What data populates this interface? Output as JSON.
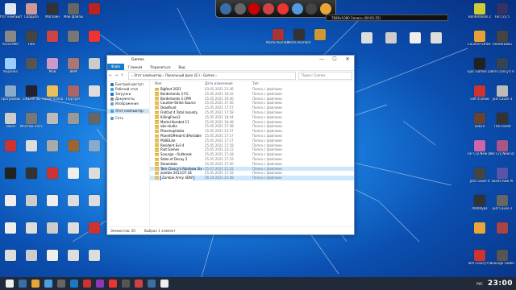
{
  "desktop": {
    "left_icons": [
      {
        "label": "Этот компьютер",
        "color": "#dfe8f5"
      },
      {
        "label": "Свадьба",
        "color": "#c99"
      },
      {
        "label": "Магазин",
        "color": "#333"
      },
      {
        "label": "Мои файлы",
        "color": "#666"
      },
      {
        "label": "",
        "color": "#b22"
      },
      {
        "label": "AccessMU",
        "color": "#888"
      },
      {
        "label": "Foto",
        "color": "#444"
      },
      {
        "label": "",
        "color": "#c44"
      },
      {
        "label": "",
        "color": "#777"
      },
      {
        "label": "",
        "color": "#e33"
      },
      {
        "label": "Корзина",
        "color": "#9cf"
      },
      {
        "label": "",
        "color": "#555"
      },
      {
        "label": "Мой",
        "color": "#c9c"
      },
      {
        "label": "ВКМ",
        "color": "#a77"
      },
      {
        "label": "",
        "color": "#ccc"
      },
      {
        "label": "Программы",
        "color": "#8ac"
      },
      {
        "label": "CINEMA 4D",
        "color": "#223"
      },
      {
        "label": "Новая папка",
        "color": "#e9c15a"
      },
      {
        "label": "Портрет",
        "color": "#a66"
      },
      {
        "label": "",
        "color": "#ddd"
      },
      {
        "label": "Заказ",
        "color": "#ccc"
      },
      {
        "label": "Монтаж 2021",
        "color": "#777"
      },
      {
        "label": "",
        "color": "#bbb"
      },
      {
        "label": "",
        "color": "#999"
      },
      {
        "label": "",
        "color": "#666"
      },
      {
        "label": "",
        "color": "#c33"
      },
      {
        "label": "",
        "color": "#ddd"
      },
      {
        "label": "",
        "color": "#aaa"
      },
      {
        "label": "",
        "color": "#963"
      },
      {
        "label": "",
        "color": "#8ac"
      },
      {
        "label": "",
        "color": "#222"
      },
      {
        "label": "",
        "color": "#333"
      },
      {
        "label": "",
        "color": "#c33"
      },
      {
        "label": "",
        "color": "#eee"
      },
      {
        "label": "",
        "color": "#ddd"
      },
      {
        "label": "",
        "color": "#eee"
      },
      {
        "label": "",
        "color": "#ccc"
      },
      {
        "label": "",
        "color": "#eee"
      },
      {
        "label": "",
        "color": "#ddd"
      },
      {
        "label": "",
        "color": "#ddd"
      },
      {
        "label": "",
        "color": "#eee"
      },
      {
        "label": "",
        "color": "#ddd"
      },
      {
        "label": "",
        "color": "#ccc"
      },
      {
        "label": "",
        "color": "#ddd"
      },
      {
        "label": "",
        "color": "#c33"
      },
      {
        "label": "",
        "color": "#ddd"
      },
      {
        "label": "",
        "color": "#ccc"
      },
      {
        "label": "",
        "color": "#eee"
      },
      {
        "label": "",
        "color": "#ddd"
      },
      {
        "label": "",
        "color": "#ddd"
      }
    ],
    "right_icons": [
      {
        "label": "Borderlands 2",
        "color": "#cc3"
      },
      {
        "label": "Far Cry 5",
        "color": "#336"
      },
      {
        "label": "Counter-Strike Global Off...",
        "color": "#e7a13a"
      },
      {
        "label": "RocketDoku",
        "color": "#444"
      },
      {
        "label": "Epic Games Launcher",
        "color": "#222"
      },
      {
        "label": "Tom Clancy's Rainbow Six",
        "color": "#345"
      },
      {
        "label": "Left 4 Dead",
        "color": "#c33"
      },
      {
        "label": "Just Cause 3",
        "color": "#bbb"
      },
      {
        "label": "Sekiro",
        "color": "#643"
      },
      {
        "label": "The Forest",
        "color": "#333"
      },
      {
        "label": "Far Cry New Dawn",
        "color": "#c6a"
      },
      {
        "label": "Far Cry New Dawn",
        "color": "#a58"
      },
      {
        "label": "Just Cause 4",
        "color": "#444"
      },
      {
        "label": "Saints Row IV",
        "color": "#55a"
      },
      {
        "label": "Prototype",
        "color": "#333"
      },
      {
        "label": "Just Cause 2",
        "color": "#666"
      },
      {
        "label": "",
        "color": "#e8a53a"
      },
      {
        "label": "",
        "color": "#a44"
      },
      {
        "label": "Tom Clancy's Rainbow Six",
        "color": "#c33"
      },
      {
        "label": "Scourge Outbreak",
        "color": "#555"
      }
    ],
    "mid_icons": [
      {
        "label": "Mortal Kombat 11",
        "color": "#a33"
      },
      {
        "label": "Mortal Kombat 11",
        "color": "#333"
      },
      {
        "label": "",
        "color": "#c93"
      },
      {
        "label": "",
        "color": "#ddd"
      },
      {
        "label": "",
        "color": "#ccc"
      },
      {
        "label": "",
        "color": "#eee"
      },
      {
        "label": "",
        "color": "#ddd"
      }
    ]
  },
  "dock": {
    "icons": [
      "#3a6ea8",
      "#666",
      "#c00",
      "#c44",
      "#e33",
      "#5599dd",
      "#444",
      "#e8a53a"
    ]
  },
  "hud": {
    "text": "7680x1080   Запись (00:01:25)"
  },
  "explorer": {
    "title": "Games",
    "window_controls": [
      "—",
      "☐",
      "✕"
    ],
    "ribbon": {
      "file": "Файл",
      "tabs": [
        "Главная",
        "Поделиться",
        "Вид"
      ]
    },
    "address": {
      "path": "›  Этот компьютер  ›  Локальный диск (E:)  ›  Games  ›",
      "search": "Поиск: Games"
    },
    "nav": {
      "items": [
        {
          "label": "Быстрый доступ",
          "color": "#1979ca"
        },
        {
          "label": "Рабочий стол",
          "color": "#4a9fe0"
        },
        {
          "label": "Загрузки",
          "color": "#1979ca"
        },
        {
          "label": "Документы",
          "color": "#888"
        },
        {
          "label": "Изображения",
          "color": "#6a9fd8"
        },
        {
          "label": "Этот компьютер",
          "color": "#4a9fe0"
        },
        {
          "label": "Сеть",
          "color": "#4a9fe0"
        }
      ]
    },
    "columns": {
      "name": "Имя",
      "date": "Дата изменения",
      "type": "Тип"
    },
    "files": [
      {
        "name": "Bigfoot 2021",
        "date": "03.05.2021 22:36",
        "type": "Папка с файлами"
      },
      {
        "name": "Borderlands 3 FG",
        "date": "25.05.2021 16:42",
        "type": "Папка с файлами"
      },
      {
        "name": "Borderlands 3 CPM",
        "date": "25.05.2021 16:40",
        "type": "Папка с файлами"
      },
      {
        "name": "Counter-Strike Source",
        "date": "25.05.2021 17:56",
        "type": "Папка с файлами"
      },
      {
        "name": "Deadhunt",
        "date": "25.05.2021 17:57",
        "type": "Папка с файлами"
      },
      {
        "name": "FlatOut 4 Total Insanity",
        "date": "25.05.2021 17:58",
        "type": "Папка с файлами"
      },
      {
        "name": "KillingFloor2",
        "date": "25.05.2021 18:44",
        "type": "Папка с файлами"
      },
      {
        "name": "Mortal Kombat 11",
        "date": "25.05.2021 19:48",
        "type": "Папка с файлами"
      },
      {
        "name": "obs-studio",
        "date": "25.05.2021 17:38",
        "type": "Папка с файлами"
      },
      {
        "name": "Phasmophobia",
        "date": "15.05.2021 22:57",
        "type": "Папка с файлами"
      },
      {
        "name": "PlanetOfHeat-0.4Portable",
        "date": "25.05.2021 17:17",
        "type": "Папка с файлами"
      },
      {
        "name": "PUBGLite",
        "date": "25.05.2021 17:17",
        "type": "Папка с файлами"
      },
      {
        "name": "Resident Evil 4",
        "date": "25.05.2021 17:18",
        "type": "Папка с файлами"
      },
      {
        "name": "Riot Games",
        "date": "25.05.2021 23:12",
        "type": "Папка с файлами"
      },
      {
        "name": "Scourge - Outbreak",
        "date": "25.05.2021 17:18",
        "type": "Папка с файлами"
      },
      {
        "name": "State of Decay 2",
        "date": "25.05.2021 17:19",
        "type": "Папка с файлами"
      },
      {
        "name": "Steamlabs",
        "date": "25.05.2021 17:20",
        "type": "Папка с файлами"
      },
      {
        "name": "Tom Clancy's Rainbow Six - Lockdown",
        "date": "25.07.2021 21:22",
        "type": "Папка с файлами"
      },
      {
        "name": "zombie 2013,07.18",
        "date": "25.05.2021 17:18",
        "type": "Папка с файлами"
      },
      {
        "name": "Zombie Army 4DW",
        "date": "26.10.2021 21:48",
        "type": "Папка с файлами"
      }
    ],
    "selected_index": 17,
    "editing_index": 19,
    "status": {
      "count": "Элементов: 20",
      "selected": "Выбран 1 элемент"
    }
  },
  "taskbar": {
    "icons": [
      "#eee",
      "#3a6ea8",
      "#e8a53a",
      "#4a9fe0",
      "#666",
      "#1979ca",
      "#c33",
      "#8a3ab8",
      "#e33",
      "#555",
      "#c44",
      "#3a6ea8",
      "#eee"
    ],
    "lang": "РУС",
    "clock": "23:00"
  }
}
